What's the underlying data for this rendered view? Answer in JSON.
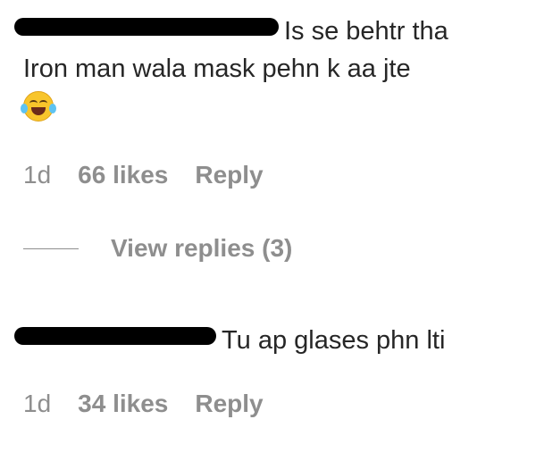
{
  "comments": [
    {
      "text_line1": "Is se behtr tha",
      "text_line2": "Iron man wala mask pehn k aa jte",
      "emoji": "face-with-tears-of-joy",
      "time": "1d",
      "likes": "66 likes",
      "reply_label": "Reply",
      "view_replies": "View replies (3)"
    },
    {
      "text_line1": "Tu ap glases phn lti",
      "time": "1d",
      "likes": "34 likes",
      "reply_label": "Reply"
    }
  ],
  "colors": {
    "text": "#262626",
    "secondary": "#8e8e8e",
    "redaction": "#000000"
  }
}
